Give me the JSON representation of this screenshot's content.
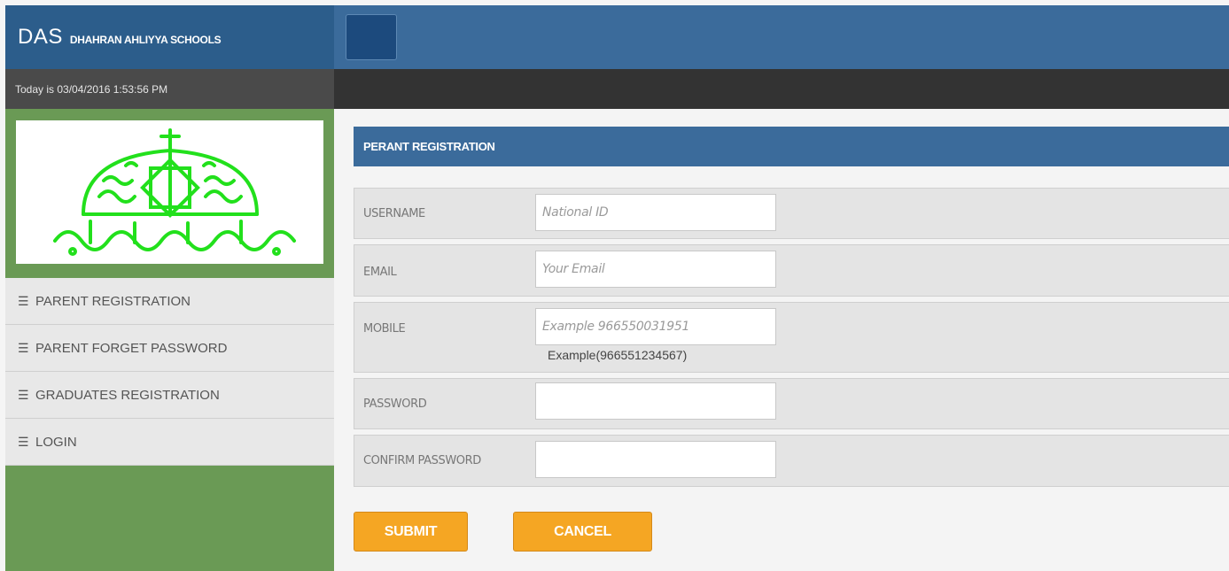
{
  "header": {
    "brand_big": "DAS",
    "brand_small": "DHAHRAN AHLIYYA SCHOOLS",
    "date_text": "Today is 03/04/2016 1:53:56 PM"
  },
  "sidebar": {
    "items": [
      {
        "label": "PARENT REGISTRATION"
      },
      {
        "label": "PARENT FORGET PASSWORD"
      },
      {
        "label": "GRADUATES REGISTRATION"
      },
      {
        "label": "LOGIN"
      }
    ]
  },
  "form": {
    "title": "PERANT REGISTRATION",
    "fields": [
      {
        "label": "USERNAME",
        "placeholder": "National ID"
      },
      {
        "label": "EMAIL",
        "placeholder": "Your Email"
      },
      {
        "label": "MOBILE",
        "placeholder": "Example 966550031951",
        "hint": "Example(966551234567)"
      },
      {
        "label": "PASSWORD",
        "placeholder": ""
      },
      {
        "label": "CONFIRM PASSWORD",
        "placeholder": ""
      }
    ],
    "submit_label": "SUBMIT",
    "cancel_label": "CANCEL"
  },
  "colors": {
    "header_dark": "#2c5d8b",
    "header_blue": "#3b6b9b",
    "sidebar_green": "#6a9a55",
    "logo_green": "#22e01c",
    "button_orange": "#f5a623"
  },
  "icons": {
    "nav_icon": "hamburger-icon",
    "menu_toggle": "menu-toggle-button"
  }
}
